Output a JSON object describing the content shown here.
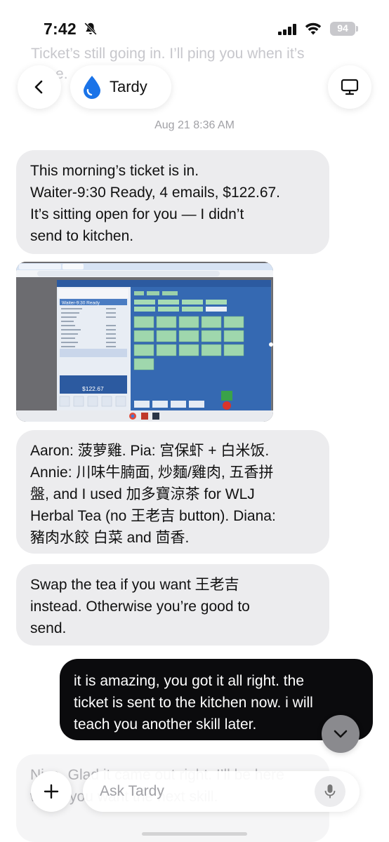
{
  "status_bar": {
    "time": "7:42",
    "battery": "94",
    "icons": [
      "bell-slash-icon",
      "cellular-signal-icon",
      "wifi-icon",
      "battery-icon"
    ]
  },
  "header": {
    "assistant_name": "Tardy",
    "back_icon": "chevron-left-icon",
    "avatar_icon": "water-drop-icon",
    "screen_icon": "monitor-icon",
    "faded_text": "Ticket’s still going in. I’ll ping you when it’s done."
  },
  "thread": {
    "date": "Aug 21 8:36 AM",
    "message1": {
      "line1": "This morning’s ticket is in.",
      "line2": "Waiter-9:30 Ready, 4 emails, $122.67.",
      "line3": "It’s sitting open for you — I didn’t",
      "line4": "send to kitchen."
    },
    "attachment": {
      "order_title": "Waiter-9:30 Ready",
      "total": "$122.67"
    },
    "message3": {
      "line1": "Aaron: 菠萝雞. Pia: 宫保虾 + 白米饭.",
      "line2": "Annie: 川味牛腩面, 炒麵/雞肉, 五香拼",
      "line3": "盤, and I used 加多寶涼茶 for WLJ",
      "line4": "Herbal Tea (no 王老吉 button). Diana:",
      "line5": "豬肉水餃 白菜 and 茴香."
    },
    "message4": {
      "line1": "Swap the tea if you want 王老吉",
      "line2": "instead. Otherwise you’re good to",
      "line3": "send."
    },
    "message5": {
      "line1": "it is amazing, you got it all right. the",
      "line2": "ticket is sent to the kitchen now. i will",
      "line3": "teach you another skill later."
    },
    "message6_partial": "Nice. Glad it came out right. I’ll be here when you want the next skill."
  },
  "composer": {
    "placeholder": "Ask Tardy",
    "add_icon": "plus-icon",
    "mic_icon": "microphone-icon"
  },
  "colors": {
    "incoming_bubble": "#ececee",
    "outgoing_bubble": "#0b0b0d",
    "brand_drop": "#1a73e8"
  }
}
